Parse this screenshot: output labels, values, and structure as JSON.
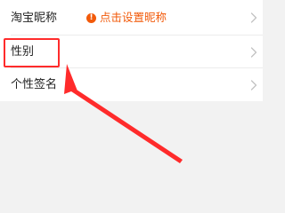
{
  "colors": {
    "accent": "#f25a0a",
    "annotation": "#ff2b2b",
    "chevron": "#c2c2c2"
  },
  "rows": [
    {
      "label": "淘宝昵称",
      "value": "点击设置昵称",
      "icon": "info-icon",
      "chevron_icon": "chevron-right-icon"
    },
    {
      "label": "性别",
      "chevron_icon": "chevron-right-icon"
    },
    {
      "label": "个性签名",
      "chevron_icon": "chevron-right-icon"
    }
  ],
  "info_icon_glyph": "!"
}
